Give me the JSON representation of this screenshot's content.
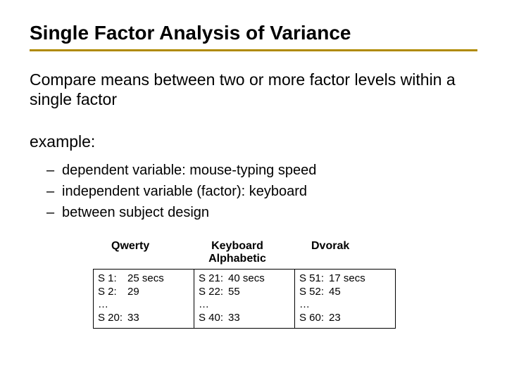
{
  "title": "Single Factor Analysis of Variance",
  "body": "Compare means between two or more factor levels within a single factor",
  "example_label": "example:",
  "bullets": [
    "dependent variable: mouse-typing speed",
    "independent variable (factor): keyboard",
    "between subject design"
  ],
  "table": {
    "super_header": "Keyboard",
    "headers": [
      "Qwerty",
      "Alphabetic",
      "Dvorak"
    ],
    "columns": [
      [
        {
          "sid": "S 1:",
          "val": "25 secs"
        },
        {
          "sid": "S 2:",
          "val": "29"
        },
        {
          "sid": "…",
          "val": ""
        },
        {
          "sid": "S 20:",
          "val": "33"
        }
      ],
      [
        {
          "sid": "S 21:",
          "val": "40 secs"
        },
        {
          "sid": "S 22:",
          "val": "55"
        },
        {
          "sid": "…",
          "val": ""
        },
        {
          "sid": "S 40:",
          "val": "33"
        }
      ],
      [
        {
          "sid": "S 51:",
          "val": "17 secs"
        },
        {
          "sid": "S 52:",
          "val": "45"
        },
        {
          "sid": "…",
          "val": ""
        },
        {
          "sid": "S 60:",
          "val": "23"
        }
      ]
    ]
  }
}
